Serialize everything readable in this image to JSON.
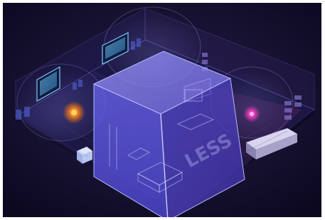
{
  "scene": {
    "description_kind": "isometric-smart-home-render",
    "accent_colors": {
      "background": "#100c28",
      "cube_fill": "#5b5fe0",
      "cube_edge": "#9aa0ff",
      "heat_orange": "#ff9a2e",
      "heat_magenta": "#ff4fd0",
      "wall_glow": "#7f86ff"
    },
    "watermark_text": "LESS"
  }
}
